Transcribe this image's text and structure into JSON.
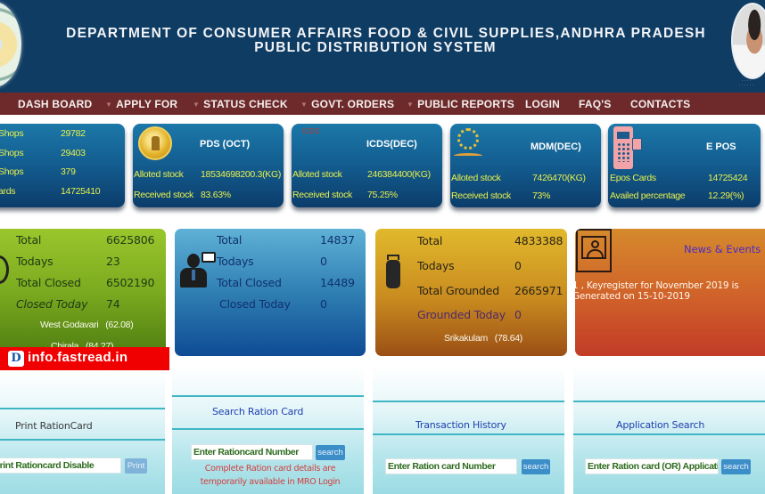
{
  "header": {
    "title_line1": "DEPARTMENT OF CONSUMER AFFAIRS FOOD & CIVIL SUPPLIES,ANDHRA PRADESH",
    "title_line2": "PUBLIC DISTRIBUTION SYSTEM"
  },
  "nav": {
    "items": [
      {
        "label": "DASH BOARD",
        "has_dropdown": false
      },
      {
        "label": "APPLY FOR",
        "has_dropdown": true
      },
      {
        "label": "STATUS CHECK",
        "has_dropdown": true
      },
      {
        "label": "GOVT. ORDERS",
        "has_dropdown": true
      },
      {
        "label": "PUBLIC REPORTS",
        "has_dropdown": true
      },
      {
        "label": "LOGIN",
        "has_dropdown": false
      },
      {
        "label": "FAQ'S",
        "has_dropdown": false
      },
      {
        "label": "CONTACTS",
        "has_dropdown": false
      }
    ],
    "caret": "▼"
  },
  "stat_cards": {
    "shops": {
      "rows": [
        {
          "label": "Shops",
          "value": "29782"
        },
        {
          "label": "Shops",
          "value": "29403"
        },
        {
          "label": "Shops",
          "value": "379"
        },
        {
          "label": "ards",
          "value": "14725410"
        }
      ]
    },
    "pds": {
      "title": "PDS (OCT)",
      "rows": [
        {
          "label": "Alloted stock",
          "value": "18534698200.3(KG)"
        },
        {
          "label": "Received stock",
          "value": "83.63%"
        }
      ]
    },
    "icds": {
      "title": "ICDS(DEC)",
      "rows": [
        {
          "label": "Alloted stock",
          "value": "246384400(KG)"
        },
        {
          "label": "Received stock",
          "value": "75.25%"
        }
      ]
    },
    "mdm": {
      "title": "MDM(DEC)",
      "rows": [
        {
          "label": "Alloted stock",
          "value": "7426470(KG)"
        },
        {
          "label": "Received stock",
          "value": "73%"
        }
      ]
    },
    "epos": {
      "title": "E POS",
      "rows": [
        {
          "label": "Epos Cards",
          "value": "14725424"
        },
        {
          "label": "Availed percentage",
          "value": "12.29(%)"
        }
      ]
    }
  },
  "summary_cards": {
    "green": {
      "rows": [
        {
          "label": "Total",
          "value": "6625806"
        },
        {
          "label": "Todays",
          "value": "23"
        },
        {
          "label": "Total Closed",
          "value": "6502190"
        },
        {
          "label": "Closed Today",
          "value": "74"
        }
      ],
      "footers": [
        {
          "name": "West Godavari",
          "value": "(62.08)"
        },
        {
          "name": "Chirala",
          "value": "(84.27)"
        }
      ]
    },
    "blue": {
      "rows": [
        {
          "label": "Total",
          "value": "14837"
        },
        {
          "label": "Todays",
          "value": "0"
        },
        {
          "label": "Total Closed",
          "value": "14489"
        },
        {
          "label": "Closed Today",
          "value": "0"
        }
      ]
    },
    "gold": {
      "rows": [
        {
          "label": "Total",
          "value": "4833388"
        },
        {
          "label": "Todays",
          "value": "0"
        },
        {
          "label": "Total Grounded",
          "value": "2665971"
        },
        {
          "label": "Grounded Today",
          "value": "0"
        }
      ],
      "footer": {
        "name": "Srikakulam",
        "value": "(78.64)"
      }
    },
    "news": {
      "title": "News & Events",
      "body": "1 , Keyregister for November 2019 is Generated on 15-10-2019"
    }
  },
  "watermark": {
    "logo_letter": "D",
    "text": "info.fastread.in"
  },
  "panels": {
    "print": {
      "title": "Print RationCard",
      "input_value": "Print Rationcard Disable",
      "button_label": "Print"
    },
    "search": {
      "title": "Search Ration Card",
      "input_placeholder": "Enter Rationcard Number",
      "button_label": "search",
      "note": "Complete Ration card details are temporarily available in MRO Login"
    },
    "transaction": {
      "title": "Transaction History",
      "input_placeholder": "Enter Ration card Number",
      "button_label": "search"
    },
    "application": {
      "title": "Application Search",
      "input_placeholder": "Enter Ration card (OR) Application",
      "button_label": "search"
    }
  },
  "colors": {
    "header_bg": "#0f3c63",
    "nav_bg": "#6e2a2a",
    "stat_value_text": "#e8f04a",
    "watermark_bg": "#f00000",
    "button_bg": "#3c8ec9",
    "note_text": "#d43d3d"
  }
}
